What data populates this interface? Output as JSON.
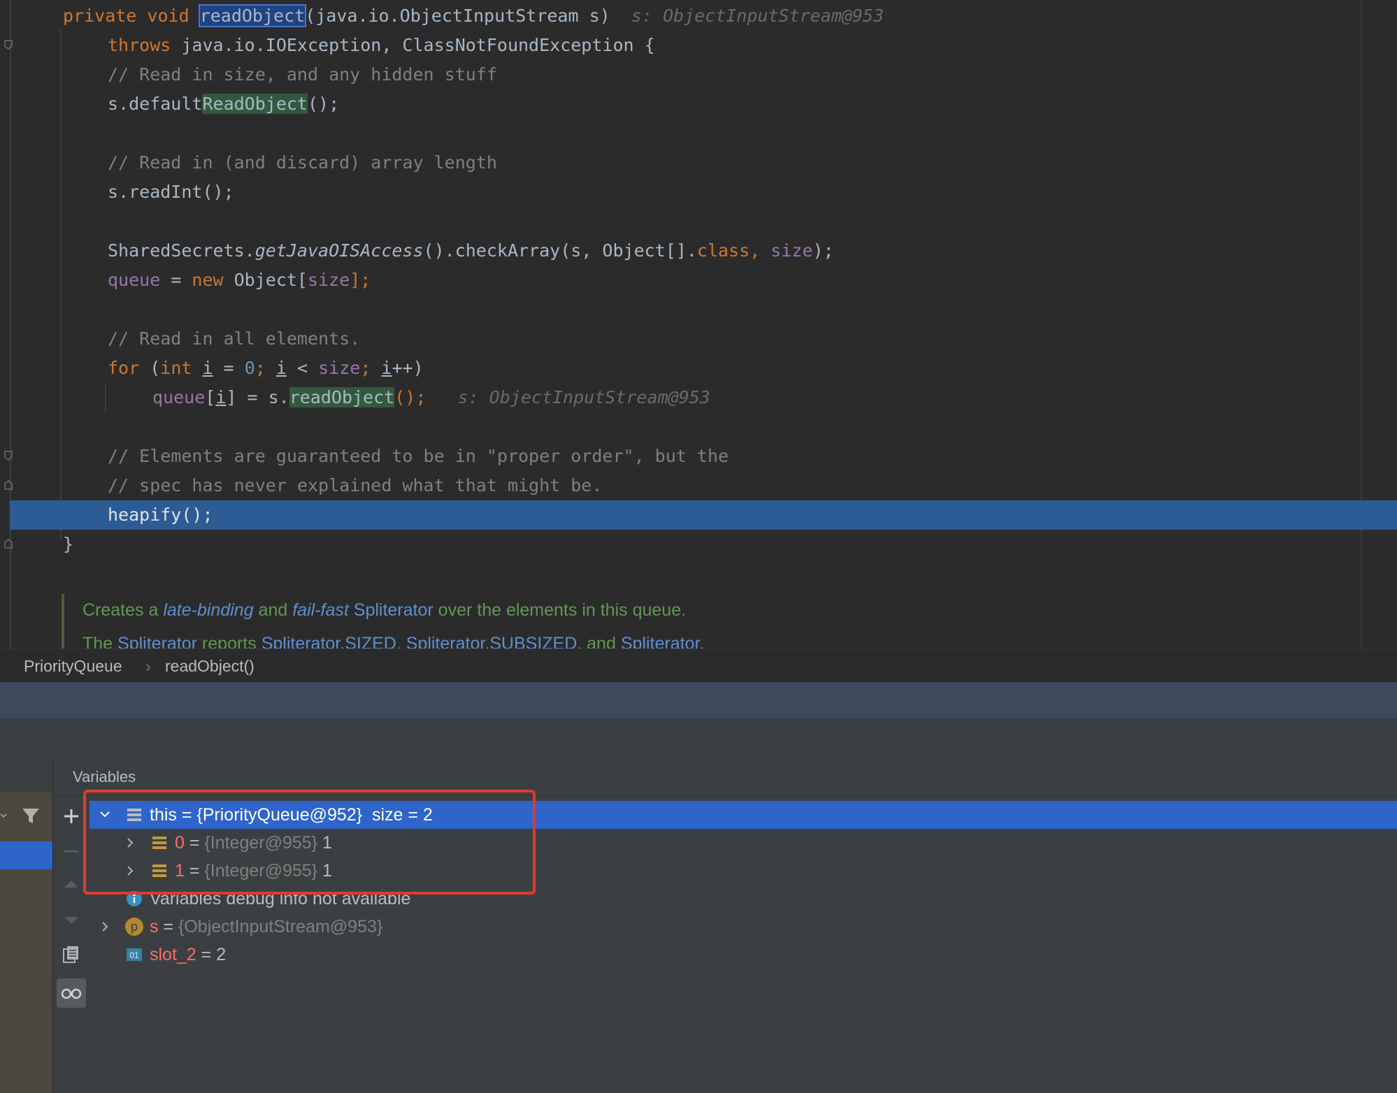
{
  "editor": {
    "signature": {
      "modifiers": "private void ",
      "method": "readObject",
      "params": "(java.io.ObjectInputStream s)",
      "hint": "s: ObjectInputStream@953"
    },
    "throws_kw": "throws ",
    "throws_rest": "java.io.IOException, ClassNotFoundException {",
    "comment1": "// Read in size, and any hidden stuff",
    "line_default_prefix": "s.default",
    "line_default_call": "ReadObject",
    "line_default_suffix": "();",
    "comment2": "// Read in (and discard) array length",
    "line_readint": "s.readInt();",
    "line_check": {
      "a": "SharedSecrets.",
      "b": "getJavaOISAccess",
      "c": "().checkArray(s, Object[].",
      "d": "class",
      "e": ", ",
      "f": "size",
      "g": ");"
    },
    "line_queue": {
      "field": "queue",
      "eq": " = ",
      "kw_new": "new",
      "rest": " Object[",
      "size": "size",
      "end": "];"
    },
    "comment3": "// Read in all elements.",
    "line_for": {
      "kw_for": "for",
      "open": " (",
      "kw_int": "int",
      "i1": "i",
      "eq": " = ",
      "zero": "0",
      "semi": "; ",
      "i2": "i",
      "lt": " < ",
      "size": "size",
      "semi2": "; ",
      "i3": "i",
      "inc": "++)"
    },
    "line_assign": {
      "field": "queue",
      "br_open": "[",
      "i": "i",
      "br_close": "] = s.",
      "call": "readObject",
      "end": "();",
      "hint": "s: ObjectInputStream@953"
    },
    "comment4": "// Elements are guaranteed to be in \"proper order\", but the",
    "comment5": "// spec has never explained what that might be.",
    "line_heapify": "heapify();",
    "closing_brace": "}",
    "doc1": {
      "a": "Creates a ",
      "b": "late-binding",
      "c": " and ",
      "d": "fail-fast",
      "e": " ",
      "f": "Spliterator",
      "g": " over the elements in this queue."
    },
    "doc2": {
      "a": "The ",
      "b": "Spliterator",
      "c": " reports ",
      "d": "Spliterator.SIZED",
      "e": ", ",
      "f": "Spliterator.SUBSIZED",
      "g": ", and ",
      "h": "Spliterator."
    }
  },
  "breadcrumb": {
    "class_name": "PriorityQueue",
    "separator": "›",
    "method_name": "readObject()"
  },
  "variables": {
    "title": "Variables",
    "rows": [
      {
        "name": "this",
        "eq": " = ",
        "type": "{PriorityQueue@952}",
        "value": "  size = 2"
      },
      {
        "name": "0",
        "eq": " = ",
        "type": "{Integer@955}",
        "value": " 1"
      },
      {
        "name": "1",
        "eq": " = ",
        "type": "{Integer@955}",
        "value": " 1"
      },
      {
        "info": "Variables debug info not available"
      },
      {
        "name": "s",
        "eq": " = ",
        "type": "{ObjectInputStream@953}",
        "value": ""
      },
      {
        "name": "slot_2",
        "eq": " = ",
        "type": "",
        "value": "2"
      }
    ]
  },
  "colors": {
    "editor_bg": "#2b2b2b",
    "exec_line": "#2d5c94",
    "selection": "#2f65ca",
    "annotation_box": "#e03a2f",
    "keyword": "#cc7832",
    "field": "#9876aa",
    "comment": "#808080"
  },
  "icons": [
    "fold-marker-icon",
    "add-icon",
    "remove-icon",
    "filter-icon",
    "copy-icon",
    "glasses-icon",
    "chevron-down-icon",
    "chevron-right-icon",
    "field-icon",
    "info-icon",
    "parameter-icon",
    "local-var-icon"
  ]
}
